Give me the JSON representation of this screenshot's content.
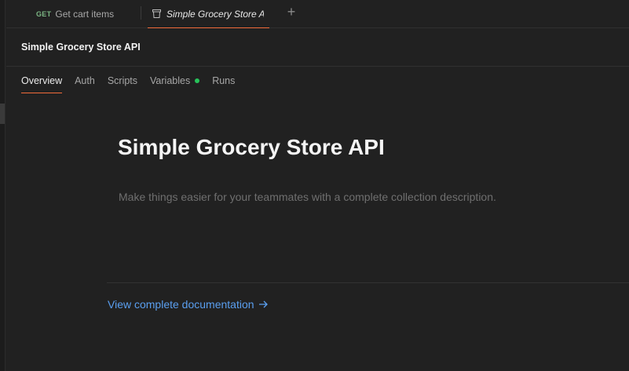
{
  "tabs": {
    "request_tab": {
      "method": "GET",
      "label": "Get cart items"
    },
    "collection_tab": {
      "label": "Simple Grocery Store AF",
      "icon": "collection-icon"
    },
    "add_tab_icon": "plus-icon"
  },
  "header": {
    "title": "Simple Grocery Store API"
  },
  "subtabs": [
    {
      "label": "Overview",
      "active": true
    },
    {
      "label": "Auth"
    },
    {
      "label": "Scripts"
    },
    {
      "label": "Variables",
      "indicator_color": "#27c35a"
    },
    {
      "label": "Runs"
    }
  ],
  "overview": {
    "title": "Simple Grocery Store API",
    "description_placeholder": "Make things easier for your teammates with a complete collection description.",
    "doc_link": "View complete documentation",
    "doc_link_icon": "arrow-right-icon"
  },
  "colors": {
    "accent": "#f26b3a",
    "link": "#5a9ff0",
    "method_get": "#7bb583"
  }
}
